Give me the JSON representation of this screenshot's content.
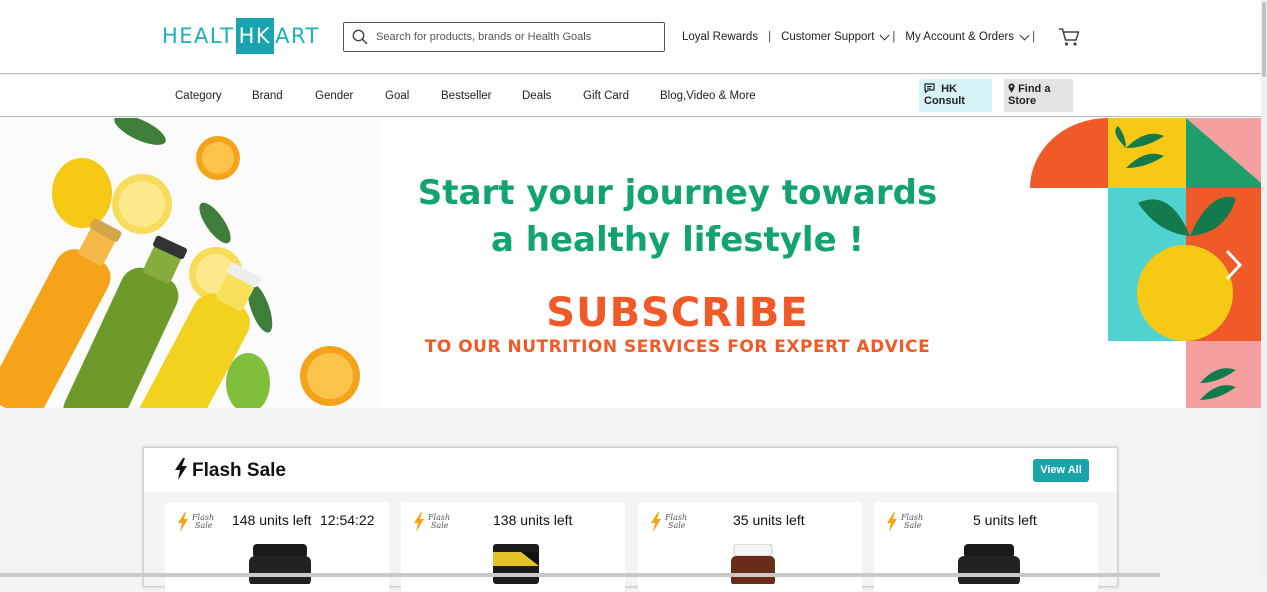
{
  "header": {
    "logo": {
      "part1": "HEALT",
      "part2": "HK",
      "part3": "ART"
    },
    "search": {
      "placeholder": "Search for products, brands or Health Goals",
      "value": ""
    },
    "links": {
      "loyal_rewards": "Loyal Rewards",
      "customer_support": "Customer Support",
      "my_account": "My Account & Orders"
    },
    "cart_icon": "cart-icon"
  },
  "nav": {
    "items": [
      "Category",
      "Brand",
      "Gender",
      "Goal",
      "Bestseller",
      "Deals",
      "Gift Card",
      "Blog,Video & More"
    ],
    "hk_consult": {
      "line1": "HK",
      "line2": "Consult"
    },
    "find_store": {
      "line1": "Find a",
      "line2": "Store"
    }
  },
  "banner": {
    "headline_line1": "Start your journey towards",
    "headline_line2": "a healthy lifestyle !",
    "cta": "SUBSCRIBE",
    "cta_sub": "TO OUR NUTRITION SERVICES FOR EXPERT ADVICE",
    "colors": {
      "green": "#13a372",
      "orange": "#f05a28"
    }
  },
  "flash_sale": {
    "title": "Flash Sale",
    "view_all": "View All",
    "badge_line1": "Flash",
    "badge_line2": "Sale",
    "cards": [
      {
        "units": "148 units left",
        "timer": "12:54:22"
      },
      {
        "units": "138 units left",
        "timer": ""
      },
      {
        "units": "35 units left",
        "timer": ""
      },
      {
        "units": "5 units left",
        "timer": ""
      }
    ]
  },
  "colors": {
    "brand_teal": "#1aa3b0",
    "button_teal": "#1aa3a9"
  }
}
